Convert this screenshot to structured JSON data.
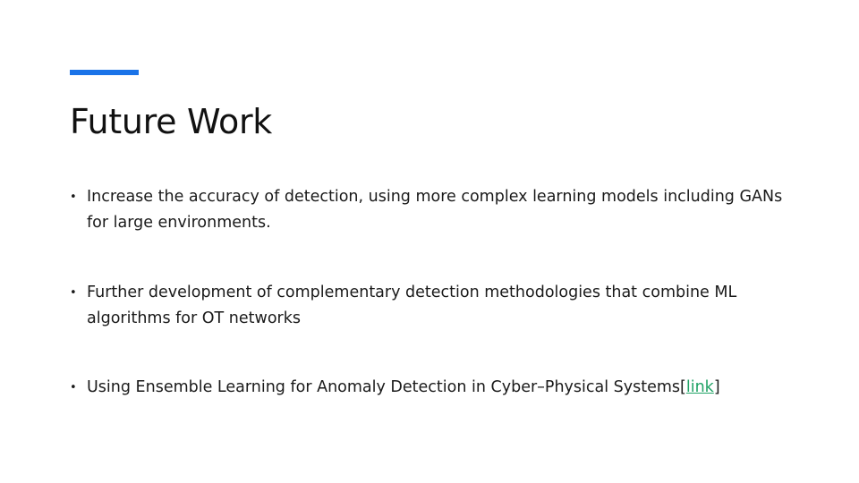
{
  "slide": {
    "title": "Future Work",
    "accent_color": "#1a73e8",
    "link_color": "#21a366",
    "bullets": [
      {
        "text": "Increase the accuracy of detection, using more complex learning models including GANs for large environments."
      },
      {
        "text": "Further development of complementary detection methodologies that combine ML algorithms for OT networks"
      },
      {
        "text": "Using Ensemble Learning for Anomaly Detection in Cyber–Physical Systems",
        "open_bracket": "[",
        "link_label": "link",
        "close_bracket": "]"
      }
    ]
  }
}
